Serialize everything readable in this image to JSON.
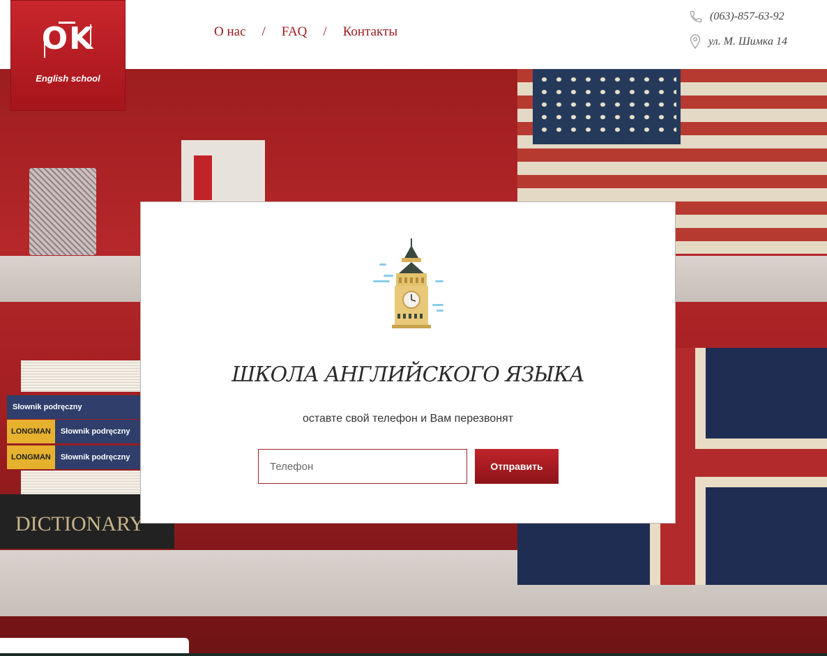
{
  "logo": {
    "mark": "OK",
    "subtitle": "English school"
  },
  "nav": {
    "items": [
      "О нас",
      "FAQ",
      "Контакты"
    ],
    "separator": "/"
  },
  "contact": {
    "phone": "(063)-857-63-92",
    "address": "ул. М. Шимка 14",
    "phone_icon": "phone-icon",
    "address_icon": "location-pin-icon"
  },
  "hero": {
    "books": {
      "spine_top": "Słownik podręczny",
      "tag": "LONGMAN",
      "spine_mid": "Słownik podręczny",
      "spine_bottom": "Słownik podręczny",
      "dictionary": "DICTIONARY"
    }
  },
  "card": {
    "icon": "big-ben-icon",
    "title": "ШКОЛА АНГЛИЙСКОГО ЯЗЫКА",
    "subtitle": "оставте свой телефон и Вам перезвонят",
    "input_placeholder": "Телефон",
    "input_value": "",
    "submit_label": "Отправить"
  },
  "colors": {
    "brand_red": "#a5151b",
    "nav_text": "#9b1c21",
    "button_top": "#c0242a",
    "button_bottom": "#8c1318"
  }
}
